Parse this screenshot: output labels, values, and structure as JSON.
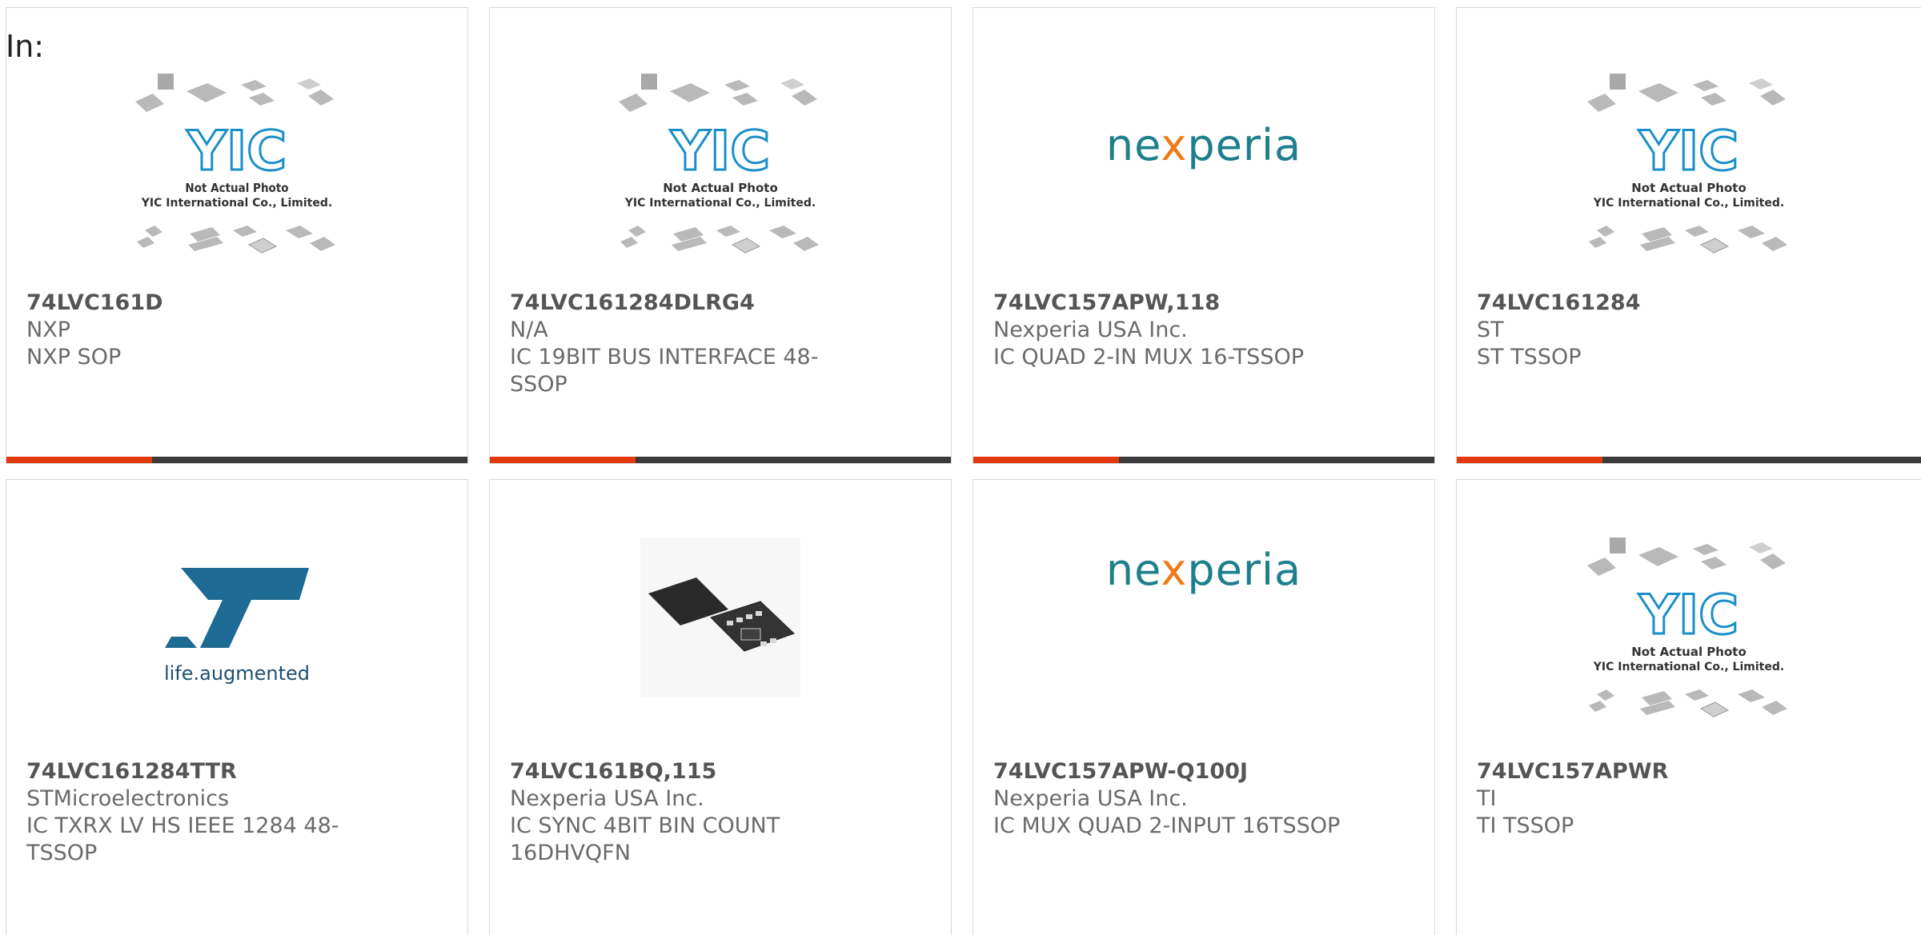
{
  "header": {
    "in_label": "In:"
  },
  "placeholder": {
    "line1": "Not Actual Photo",
    "line2": "YIC International Co., Limited.",
    "logo": "YIC"
  },
  "brand_logos": {
    "nexperia": "nexperia",
    "st_tagline": "life.augmented"
  },
  "colors": {
    "accent": "#e2390f",
    "bar_dark": "#3b3b3b",
    "nexperia": "#1e7f8c"
  },
  "products": [
    {
      "part": "74LVC161D",
      "manufacturer": "NXP",
      "description": "NXP SOP",
      "image": "placeholder"
    },
    {
      "part": "74LVC161284DLRG4",
      "manufacturer": "N/A",
      "description": "IC 19BIT BUS INTERFACE 48-SSOP",
      "image": "placeholder"
    },
    {
      "part": "74LVC157APW,118",
      "manufacturer": "Nexperia USA Inc.",
      "description": "IC QUAD 2-IN MUX 16-TSSOP",
      "image": "nexperia-logo"
    },
    {
      "part": "74LVC161284",
      "manufacturer": "ST",
      "description": "ST TSSOP",
      "image": "placeholder"
    },
    {
      "part": "74LVC161284TTR",
      "manufacturer": "STMicroelectronics",
      "description": "IC TXRX LV HS IEEE 1284 48-TSSOP",
      "image": "st-logo"
    },
    {
      "part": "74LVC161BQ,115",
      "manufacturer": "Nexperia USA Inc.",
      "description": "IC SYNC 4BIT BIN COUNT 16DHVQFN",
      "image": "chip-photo"
    },
    {
      "part": "74LVC157APW-Q100J",
      "manufacturer": "Nexperia USA Inc.",
      "description": "IC MUX QUAD 2-INPUT 16TSSOP",
      "image": "nexperia-logo"
    },
    {
      "part": "74LVC157APWR",
      "manufacturer": "TI",
      "description": "TI TSSOP",
      "image": "placeholder"
    }
  ]
}
